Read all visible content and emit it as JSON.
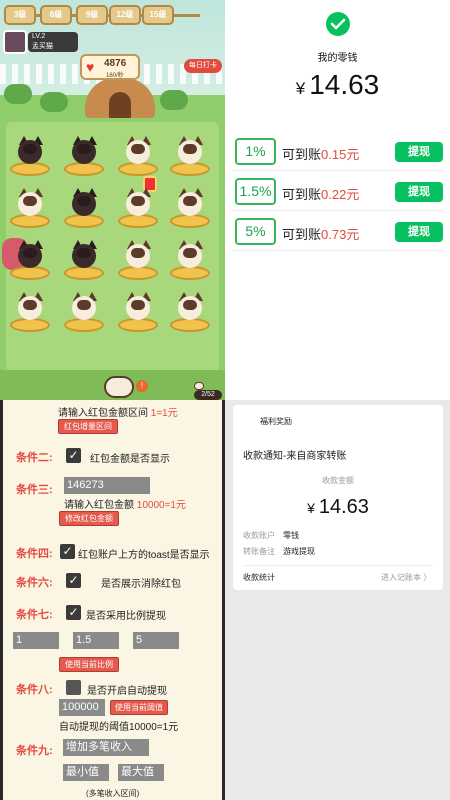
{
  "game": {
    "level_chips": [
      "3级",
      "6级",
      "9级",
      "12级",
      "15级"
    ],
    "player_level": "LV.2",
    "player_name": "孟买猫",
    "hearts": "4876",
    "heart_rate": "160/秒",
    "daily_button": "每日打卡",
    "progress_counter": "2/52",
    "bubble": "!"
  },
  "wallet": {
    "title": "我的零钱",
    "currency": "¥",
    "amount": "14.63",
    "tiers": [
      {
        "pct": "1%",
        "label": "可到账",
        "value": "0.15元",
        "button": "提现"
      },
      {
        "pct": "1.5%",
        "label": "可到账",
        "value": "0.22元",
        "button": "提现"
      },
      {
        "pct": "5%",
        "label": "可到账",
        "value": "0.73元",
        "button": "提现"
      }
    ],
    "accent": "#07c160"
  },
  "settings": {
    "line1_prefix": "请输入红包金额区间 ",
    "line1_rate": "1=1元",
    "btn_red_interval": "红包增量区间",
    "cond2_label": "条件二:",
    "cond2_text": "红包金额是否显示",
    "cond3_label": "条件三:",
    "cond3_input": "146273",
    "cond3_hint_prefix": "请输入红包金额 ",
    "cond3_hint_rate": "10000=1元",
    "btn_modify_amount": "修改红包金额",
    "cond4_label": "条件四:",
    "cond4_text": "红包账户上方的toast是否显示",
    "cond6_label": "条件六:",
    "cond6_text": "是否展示消除红包",
    "cond7_label": "条件七:",
    "cond7_text": "是否采用比例提现",
    "ratio_inputs": [
      "1",
      "1.5",
      "5"
    ],
    "btn_use_ratio": "使用当前比例",
    "cond8_label": "条件八:",
    "cond8_text": "是否开启自动提现",
    "cond8_input": "100000",
    "btn_use_threshold": "使用当前阈值",
    "cond8_hint": "自动提现的阈值10000=1元",
    "cond9_label": "条件九:",
    "cond9_input": "增加多笔收入",
    "min_input": "最小值",
    "max_input": "最大值",
    "footer_hint": "(多笔收入区间)",
    "check_mark": "✓"
  },
  "notice": {
    "header": "福利奖励",
    "title": "收款通知-来自商家转账",
    "amount_label": "收款金额",
    "currency": "¥",
    "amount": "14.63",
    "account_key": "收款账户",
    "account_value": "零钱",
    "remark_key": "转账备注",
    "remark_value": "游戏提现",
    "stats_label": "收款统计",
    "stats_link": "进入记账本 〉"
  }
}
